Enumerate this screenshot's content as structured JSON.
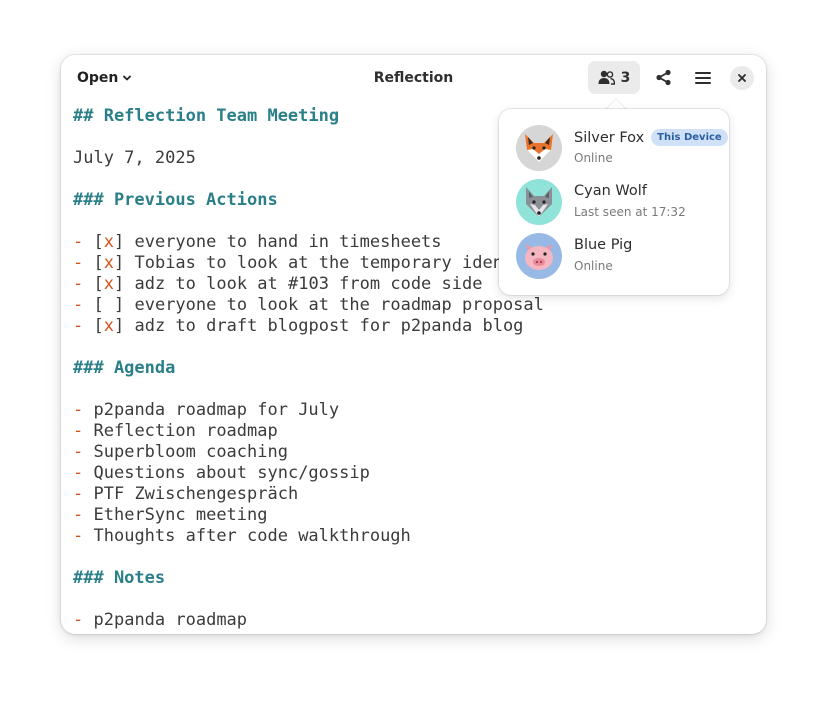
{
  "header": {
    "open_label": "Open",
    "title": "Reflection",
    "users_count": "3"
  },
  "document": {
    "lines": [
      {
        "type": "h",
        "text": "## Reflection Team Meeting"
      },
      {
        "type": "blank",
        "text": ""
      },
      {
        "type": "text",
        "text": "July 7, 2025"
      },
      {
        "type": "blank",
        "text": ""
      },
      {
        "type": "h",
        "text": "### Previous Actions"
      },
      {
        "type": "blank",
        "text": ""
      },
      {
        "type": "task",
        "done": true,
        "text": "everyone to hand in timesheets"
      },
      {
        "type": "task",
        "done": true,
        "text": "Tobias to look at the temporary identity"
      },
      {
        "type": "task",
        "done": true,
        "text": "adz to look at #103 from code side"
      },
      {
        "type": "task",
        "done": false,
        "text": "everyone to look at the roadmap proposal"
      },
      {
        "type": "task",
        "done": true,
        "text": "adz to draft blogpost for p2panda blog"
      },
      {
        "type": "blank",
        "text": ""
      },
      {
        "type": "h",
        "text": "### Agenda"
      },
      {
        "type": "blank",
        "text": ""
      },
      {
        "type": "bullet",
        "text": "p2panda roadmap for July"
      },
      {
        "type": "bullet",
        "text": "Reflection roadmap"
      },
      {
        "type": "bullet",
        "text": "Superbloom coaching"
      },
      {
        "type": "bullet",
        "text": "Questions about sync/gossip"
      },
      {
        "type": "bullet",
        "text": "PTF Zwischengespräch"
      },
      {
        "type": "bullet",
        "text": "EtherSync meeting"
      },
      {
        "type": "bullet",
        "text": "Thoughts after code walkthrough"
      },
      {
        "type": "blank",
        "text": ""
      },
      {
        "type": "h",
        "text": "### Notes"
      },
      {
        "type": "blank",
        "text": ""
      },
      {
        "type": "bullet",
        "text": "p2panda roadmap"
      }
    ]
  },
  "popover": {
    "users": [
      {
        "name": "Silver Fox",
        "status": "Online",
        "badge": "This Device",
        "avatar": "fox-avatar",
        "bg": "#d6d6d6"
      },
      {
        "name": "Cyan Wolf",
        "status": "Last seen at 17:32",
        "badge": "",
        "avatar": "wolf-avatar",
        "bg": "#8fe3d9"
      },
      {
        "name": "Blue Pig",
        "status": "Online",
        "badge": "",
        "avatar": "pig-avatar",
        "bg": "#98b9e6"
      }
    ]
  },
  "colors": {
    "heading": "#2a7f89",
    "bullet": "#d2541c",
    "badge_bg": "#d0e1f7",
    "badge_text": "#2a5fa6"
  }
}
